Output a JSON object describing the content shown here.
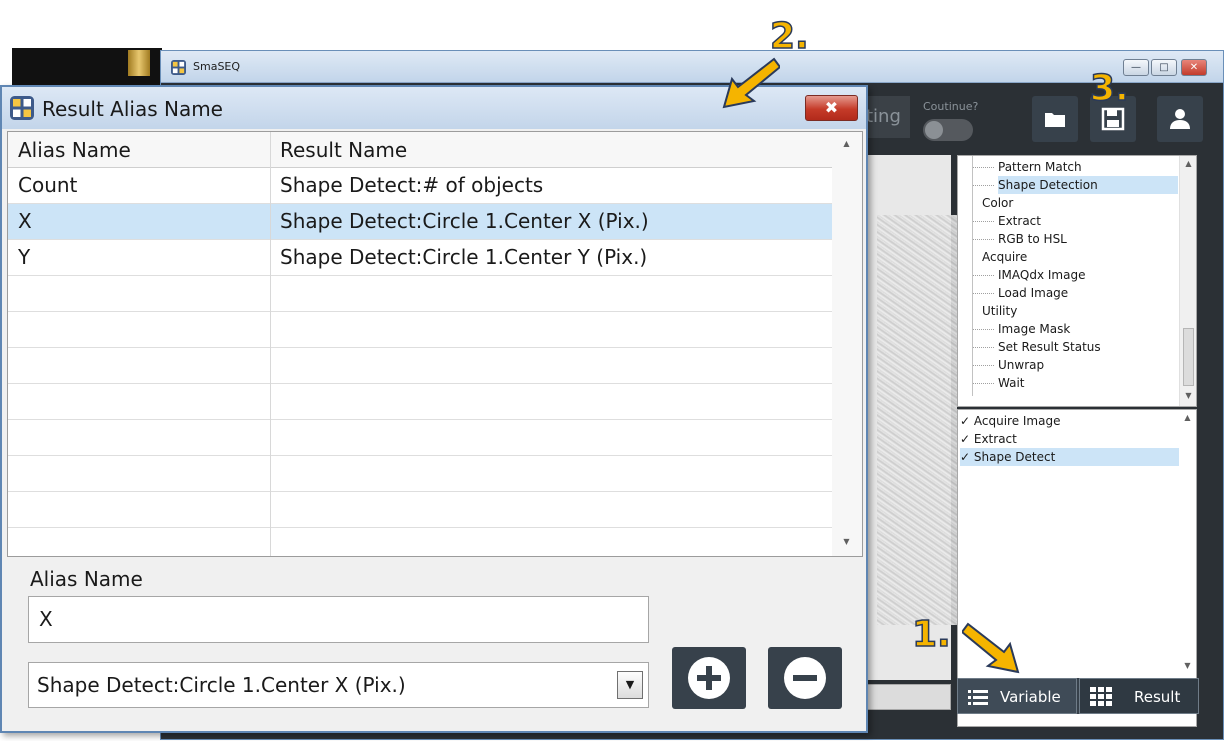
{
  "main_window": {
    "title": "SmaSEQ",
    "toolbar": {
      "partial_button_label": "ting",
      "continue_label": "Coutinue?"
    }
  },
  "palette": {
    "items": [
      {
        "label": "Pattern Match",
        "level": "child",
        "selected": false
      },
      {
        "label": "Shape Detection",
        "level": "child",
        "selected": true
      },
      {
        "label": "Color",
        "level": "group",
        "selected": false
      },
      {
        "label": "Extract",
        "level": "child",
        "selected": false
      },
      {
        "label": "RGB to HSL",
        "level": "child",
        "selected": false
      },
      {
        "label": "Acquire",
        "level": "group",
        "selected": false
      },
      {
        "label": "IMAQdx Image",
        "level": "child",
        "selected": false
      },
      {
        "label": "Load Image",
        "level": "child",
        "selected": false
      },
      {
        "label": "Utility",
        "level": "group",
        "selected": false
      },
      {
        "label": "Image Mask",
        "level": "child",
        "selected": false
      },
      {
        "label": "Set Result Status",
        "level": "child",
        "selected": false
      },
      {
        "label": "Unwrap",
        "level": "child",
        "selected": false
      },
      {
        "label": "Wait",
        "level": "child",
        "selected": false
      }
    ]
  },
  "steps": {
    "items": [
      {
        "label": "✓ Acquire Image",
        "selected": false
      },
      {
        "label": "✓ Extract",
        "selected": false
      },
      {
        "label": "✓ Shape Detect",
        "selected": true
      }
    ]
  },
  "bottom_tabs": {
    "variable": "Variable",
    "result": "Result"
  },
  "dialog": {
    "title": "Result Alias Name",
    "columns": [
      "Alias Name",
      "Result Name"
    ],
    "rows": [
      {
        "alias": "Count",
        "result": "Shape Detect:# of objects",
        "selected": false
      },
      {
        "alias": "X",
        "result": "Shape Detect:Circle 1.Center X (Pix.)",
        "selected": true
      },
      {
        "alias": "Y",
        "result": "Shape Detect:Circle 1.Center Y (Pix.)",
        "selected": false
      }
    ],
    "empty_rows": 8,
    "alias_label": "Alias Name",
    "alias_value": "X",
    "result_select_value": "Shape Detect:Circle 1.Center X (Pix.)"
  },
  "annotations": {
    "step1": "1.",
    "step2": "2.",
    "step3": "3."
  },
  "colors": {
    "accent_arrow": "#f5b400",
    "selection": "#cce4f7",
    "dark_panel": "#2b3035"
  },
  "icons": [
    "folder-icon",
    "save-icon",
    "user-icon",
    "list-icon",
    "grid-icon",
    "plus-icon",
    "minus-icon",
    "close-icon",
    "app-icon"
  ]
}
